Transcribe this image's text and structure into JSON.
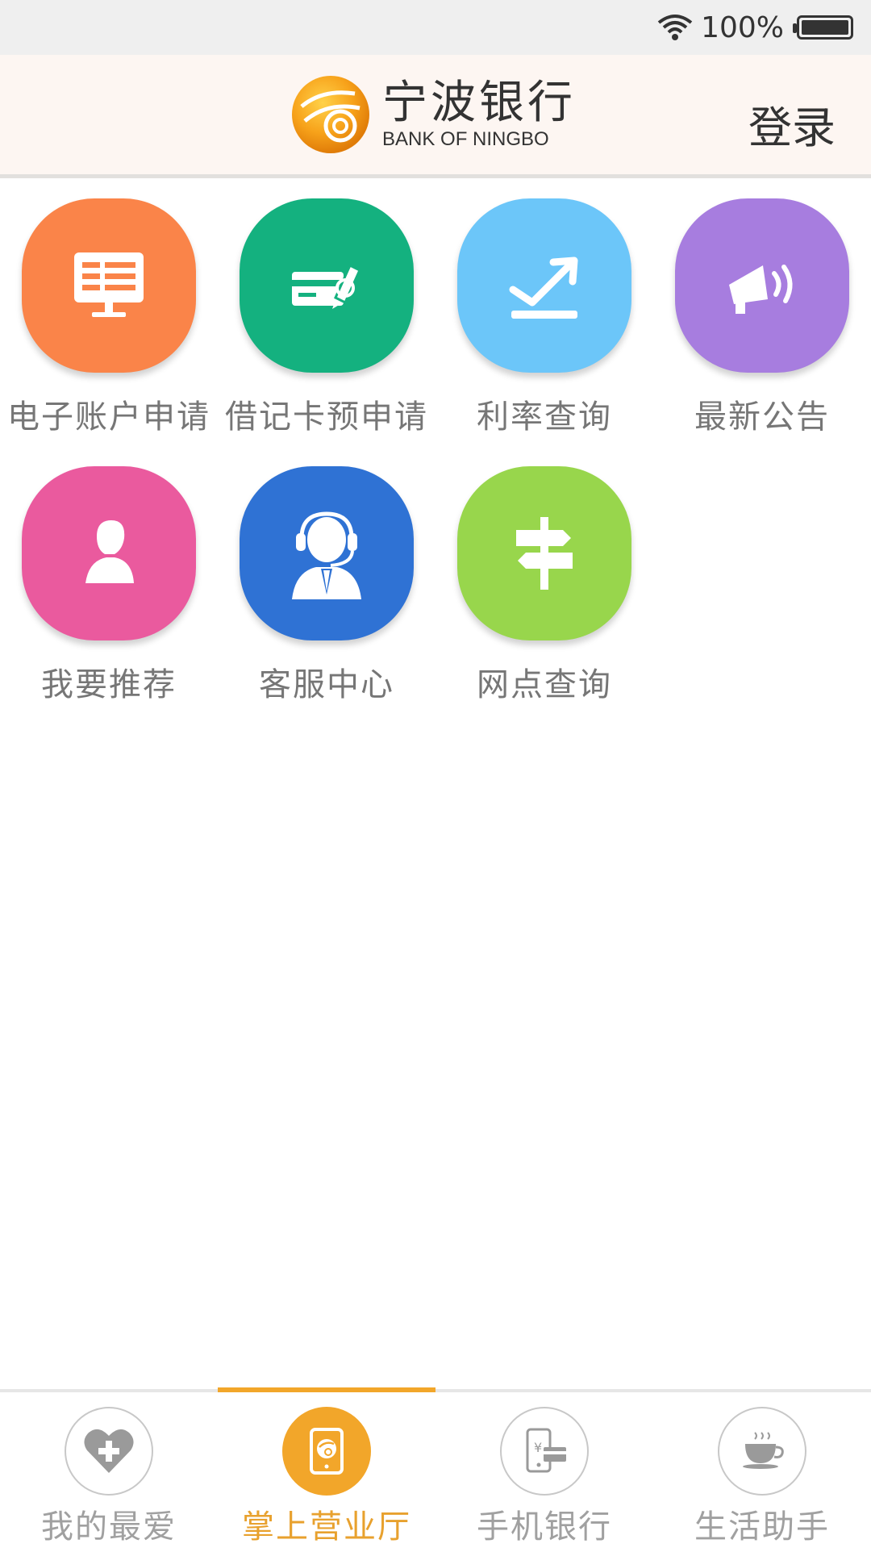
{
  "status_bar": {
    "battery_text": "100%",
    "icons": [
      "wifi-icon",
      "battery-icon"
    ]
  },
  "header": {
    "logo_cn": "宁波银行",
    "logo_en": "BANK OF NINGBO",
    "login_label": "登录"
  },
  "grid": {
    "items": [
      {
        "label": "电子账户申请",
        "icon": "monitor-icon",
        "color": "#fa8449"
      },
      {
        "label": "借记卡预申请",
        "icon": "card-pen-icon",
        "color": "#14b17f"
      },
      {
        "label": "利率查询",
        "icon": "trend-arrow-icon",
        "color": "#6cc6f9"
      },
      {
        "label": "最新公告",
        "icon": "megaphone-icon",
        "color": "#a77ddf"
      },
      {
        "label": "我要推荐",
        "icon": "person-icon",
        "color": "#ea5a9e"
      },
      {
        "label": "客服中心",
        "icon": "headset-agent-icon",
        "color": "#2f72d4"
      },
      {
        "label": "网点查询",
        "icon": "signpost-icon",
        "color": "#98d64c"
      }
    ]
  },
  "tabs": [
    {
      "label": "我的最爱",
      "icon": "heart-plus-icon",
      "active": false
    },
    {
      "label": "掌上营业厅",
      "icon": "tablet-logo-icon",
      "active": true
    },
    {
      "label": "手机银行",
      "icon": "phone-card-icon",
      "active": false
    },
    {
      "label": "生活助手",
      "icon": "coffee-cup-icon",
      "active": false
    }
  ],
  "colors": {
    "accent": "#f2a62a",
    "header_bg": "#fdf6f2",
    "label_gray": "#767676"
  }
}
